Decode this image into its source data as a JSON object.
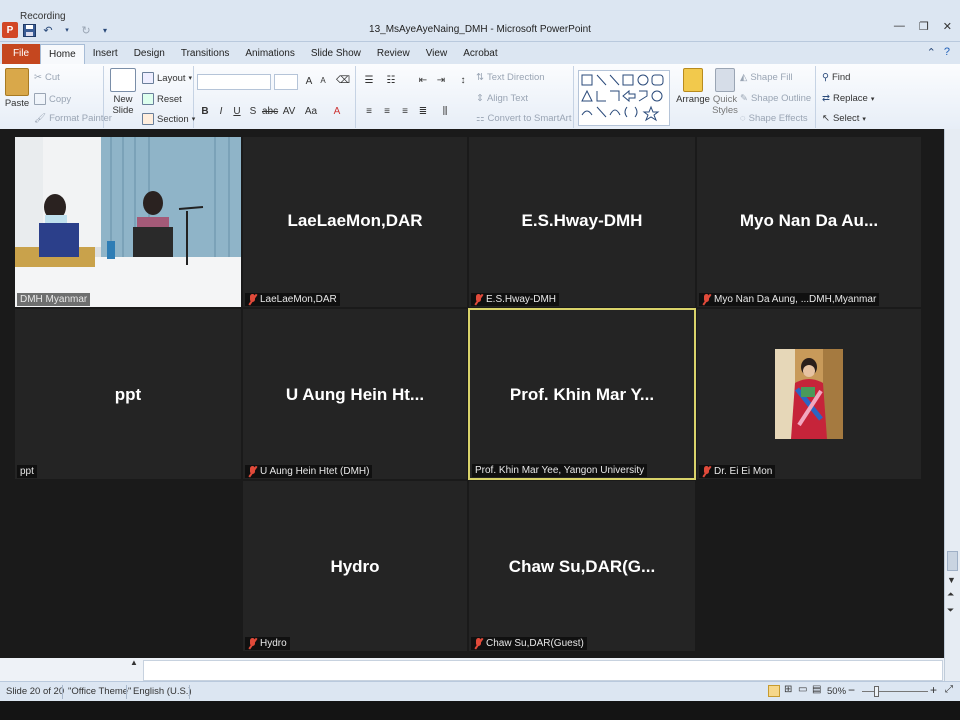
{
  "recording_label": "Recording",
  "window": {
    "title": "13_MsAyeAyeNaing_DMH  -  Microsoft PowerPoint",
    "minimize_glyph": "—",
    "restore_glyph": "❐",
    "close_glyph": "✕"
  },
  "ribbon_tabs": [
    "File",
    "Home",
    "Insert",
    "Design",
    "Transitions",
    "Animations",
    "Slide Show",
    "Review",
    "View",
    "Acrobat"
  ],
  "ribbon": {
    "clipboard": {
      "paste": "Paste",
      "cut": "Cut",
      "copy": "Copy",
      "format_painter": "Format Painter"
    },
    "slides": {
      "new_slide": "New Slide",
      "layout": "Layout",
      "reset": "Reset",
      "section": "Section"
    },
    "paragraph": {
      "text_direction": "Text Direction",
      "align_text": "Align Text",
      "convert_smartart": "Convert to SmartArt"
    },
    "drawing": {
      "arrange": "Arrange",
      "quick_styles": "Quick Styles",
      "shape_fill": "Shape Fill",
      "shape_outline": "Shape Outline",
      "shape_effects": "Shape Effects"
    },
    "editing": {
      "find": "Find",
      "replace": "Replace",
      "select": "Select"
    }
  },
  "meeting": {
    "tiles": [
      {
        "big_name": "",
        "label": "DMH Myanmar",
        "muted": false,
        "video": true
      },
      {
        "big_name": "LaeLaeMon,DAR",
        "label": "LaeLaeMon,DAR",
        "muted": true
      },
      {
        "big_name": "E.S.Hway-DMH",
        "label": "E.S.Hway-DMH",
        "muted": true
      },
      {
        "big_name": "Myo Nan Da Au...",
        "label": "Myo Nan Da Aung,   ...DMH,Myanmar",
        "muted": true
      },
      {
        "big_name": "ppt",
        "label": "ppt",
        "muted": false
      },
      {
        "big_name": "U Aung Hein Ht...",
        "label": "U Aung Hein Htet (DMH)",
        "muted": true
      },
      {
        "big_name": "Prof. Khin Mar Y...",
        "label": "Prof. Khin Mar Yee, Yangon University",
        "muted": false,
        "speaking": true
      },
      {
        "big_name": "",
        "label": "Dr. Ei Ei Mon",
        "muted": true,
        "photo": true
      },
      {
        "big_name": "Hydro",
        "label": "Hydro",
        "muted": true
      },
      {
        "big_name": "Chaw  Su,DAR(G...",
        "label": "Chaw Su,DAR(Guest)",
        "muted": true
      }
    ]
  },
  "status_bar": {
    "slide": "Slide 20 of 20",
    "theme": "\"Office Theme\"",
    "language": "English (U.S.)",
    "zoom": "50%",
    "zoom_minus": "−",
    "zoom_plus": "+"
  }
}
